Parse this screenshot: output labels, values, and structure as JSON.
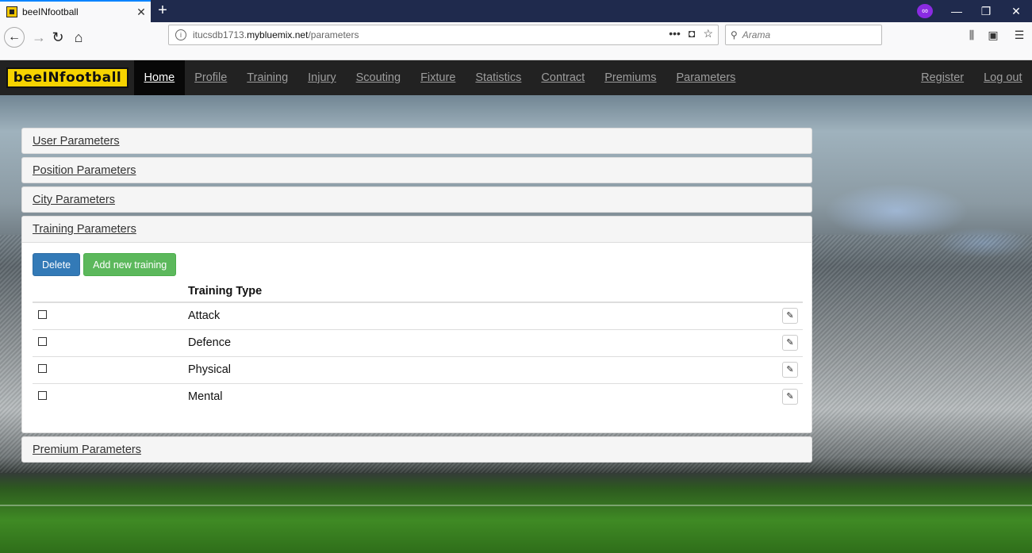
{
  "browser": {
    "tab_title": "beeINfootball",
    "tab_close": "✕",
    "new_tab": "+",
    "url_path_prefix": "itucsdb1713.",
    "url_host": "mybluemix.net",
    "url_path": "/parameters",
    "search_placeholder": "Arama",
    "window_controls": [
      "—",
      "❐",
      "✕"
    ]
  },
  "site": {
    "brand": "beeINfootball",
    "nav_links": [
      "Home",
      "Profile",
      "Training",
      "Injury",
      "Scouting",
      "Fixture",
      "Statistics",
      "Contract",
      "Premiums",
      "Parameters"
    ],
    "nav_right": [
      "Register",
      "Log out"
    ],
    "active_link": "Home"
  },
  "panels": {
    "user": "User Parameters",
    "position": "Position Parameters",
    "city": "City Parameters",
    "training": "Training Parameters",
    "premium": "Premium Parameters"
  },
  "training": {
    "delete_label": "Delete",
    "add_label": "Add new training",
    "column_header": "Training Type",
    "rows": [
      "Attack",
      "Defence",
      "Physical",
      "Mental"
    ]
  }
}
